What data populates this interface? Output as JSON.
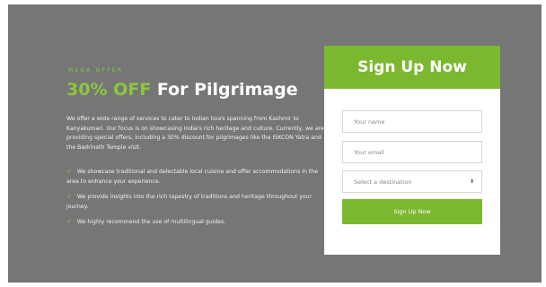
{
  "hero": {
    "offer_tag": "MEGA OFFER",
    "headline_accent": "30% OFF",
    "headline_rest": "For Pilgrimage",
    "intro": "We offer a wide range of services to cater to Indian tours spanning from Kashmir to Kanyakumari. Our focus is on showcasing India's rich heritage and culture. Currently, we are providing special offers, including a 30% discount for pilgrimages like the ISKCON Yatra and the Badrinath Temple visit.",
    "features": [
      "We showcase traditional and delectable local cuisine and offer accommodations in the area to enhance your experience.",
      "We provide insights into the rich tapestry of traditions and heritage throughout your journey.",
      "We highly recommend the use of multilingual guides."
    ]
  },
  "signup": {
    "title": "Sign Up Now",
    "name_placeholder": "Your name",
    "email_placeholder": "Your email",
    "destination_selected": "Select a destination",
    "submit_label": "Sign Up Now"
  },
  "colors": {
    "accent": "#8cc63f",
    "button": "#7cb82f",
    "background": "#767676"
  },
  "icons": {
    "feature_bullet": "check-icon",
    "select_arrow": "up-down-caret-icon"
  }
}
